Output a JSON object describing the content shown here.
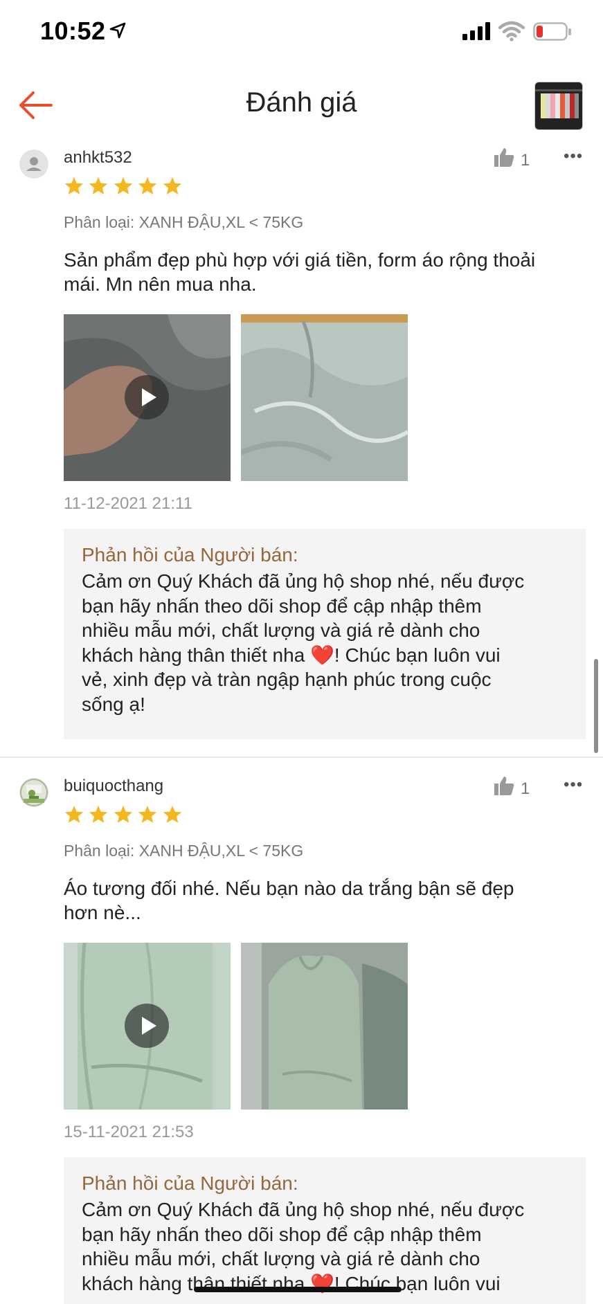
{
  "status_bar": {
    "time": "10:52",
    "icons": [
      "location-arrow-icon",
      "cellular-signal-icon",
      "wifi-icon",
      "battery-low-icon"
    ]
  },
  "header": {
    "title": "Đánh giá",
    "back_icon": "arrow-left-icon",
    "accent_color": "#e5502f"
  },
  "reviews": [
    {
      "username": "anhkt532",
      "rating": 5,
      "likes": "1",
      "variation": "Phân loại: XANH ĐẬU,XL < 75KG",
      "text_lines": [
        "Sản phẩm đẹp phù hợp với giá tiền, form áo rộng thoải",
        "mái. Mn nên mua nha."
      ],
      "media": [
        "video",
        "image"
      ],
      "date": "11-12-2021 21:11",
      "reply_title": "Phản hồi của Người bán:",
      "reply_lines": [
        "Cảm ơn Quý Khách đã ủng hộ shop nhé, nếu được",
        "bạn hãy nhấn theo dõi shop để cập nhập thêm",
        "nhiều mẫu mới, chất lượng và giá rẻ dành cho",
        "khách hàng thân thiết nha ❤️! Chúc bạn luôn vui",
        "vẻ, xinh đẹp và tràn ngập hạnh phúc trong cuộc",
        "sống ạ!"
      ]
    },
    {
      "username": "buiquocthang",
      "rating": 5,
      "likes": "1",
      "variation": "Phân loại: XANH ĐẬU,XL < 75KG",
      "text_lines": [
        "Áo tương đối nhé. Nếu bạn nào da trắng bận sẽ đẹp",
        "hơn nè..."
      ],
      "media": [
        "video",
        "image"
      ],
      "date": "15-11-2021 21:53",
      "reply_title": "Phản hồi của Người bán:",
      "reply_lines": [
        "Cảm ơn Quý Khách đã ủng hộ shop nhé, nếu được",
        "bạn hãy nhấn theo dõi shop để cập nhập thêm",
        "nhiều mẫu mới, chất lượng và giá rẻ dành cho",
        "khách hàng thân thiết nha ❤️! Chúc bạn luôn vui"
      ]
    }
  ],
  "colors": {
    "star": "#f5b71f",
    "reply_title": "#94673d",
    "reply_bg": "#f4f4f4"
  }
}
